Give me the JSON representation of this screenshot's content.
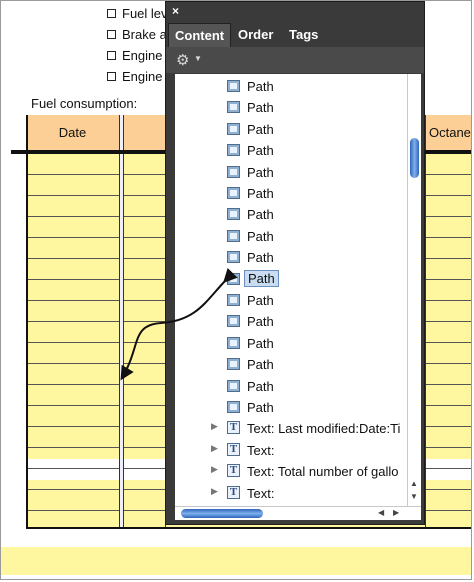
{
  "document": {
    "checklist": [
      "Fuel lev",
      "Brake a",
      "Engine",
      "Engine"
    ],
    "fuel_label": "Fuel consumption:",
    "headers": {
      "date": "Date",
      "octane": "Octane"
    }
  },
  "panel": {
    "close_label": "×",
    "tabs": [
      "Content",
      "Order",
      "Tags"
    ],
    "active_tab": "Content",
    "paths": [
      "Path",
      "Path",
      "Path",
      "Path",
      "Path",
      "Path",
      "Path",
      "Path",
      "Path",
      "Path",
      "Path",
      "Path",
      "Path",
      "Path",
      "Path",
      "Path"
    ],
    "selected_index": 9,
    "text_items": [
      "Text: Last modified:Date:Ti",
      "Text:",
      "Text: Total number of gallo",
      "Text:"
    ]
  },
  "colors": {
    "table_fill": "#fff79f",
    "header_fill": "#fccf97",
    "panel_bg": "#3a3a3a",
    "selection": "#c9dcf2"
  },
  "icons": {
    "path": "path-object-icon",
    "text": "text-object-icon",
    "gear": "gear-icon",
    "close": "close-icon",
    "disclosure": "disclosure-triangle-icon"
  }
}
